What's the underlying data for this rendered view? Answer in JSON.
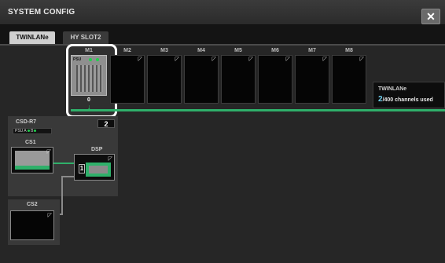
{
  "window": {
    "title": "SYSTEM CONFIG",
    "close_glyph": "✕"
  },
  "tabs": [
    {
      "label": "TWINLANe",
      "active": true
    },
    {
      "label": "HY SLOT2",
      "active": false
    }
  ],
  "slots": [
    {
      "label": "M1",
      "value": "0",
      "psu": "PSU",
      "led_a": "A",
      "led_b": "B"
    },
    {
      "label": "M2"
    },
    {
      "label": "M3"
    },
    {
      "label": "M4"
    },
    {
      "label": "M5"
    },
    {
      "label": "M6"
    },
    {
      "label": "M7"
    },
    {
      "label": "M8"
    }
  ],
  "twinlane": {
    "label": "TWINLANe",
    "used": "2",
    "suffix": "/400 channels used"
  },
  "csd": {
    "label": "CSD-R7",
    "psu": "PSU",
    "led_a": "A",
    "led_b": "B",
    "number": "2"
  },
  "cs1": {
    "label": "CS1"
  },
  "dsp": {
    "label": "DSP",
    "badge": "1"
  },
  "cs2": {
    "label": "CS2"
  },
  "colors": {
    "accent_green": "#2fb06a",
    "count_blue": "#6fd1f0",
    "highlight": "#ffffff"
  },
  "icons": {
    "close": "close-icon",
    "expand": "expand-corner-icon",
    "arrow": "down-arrow-icon"
  }
}
